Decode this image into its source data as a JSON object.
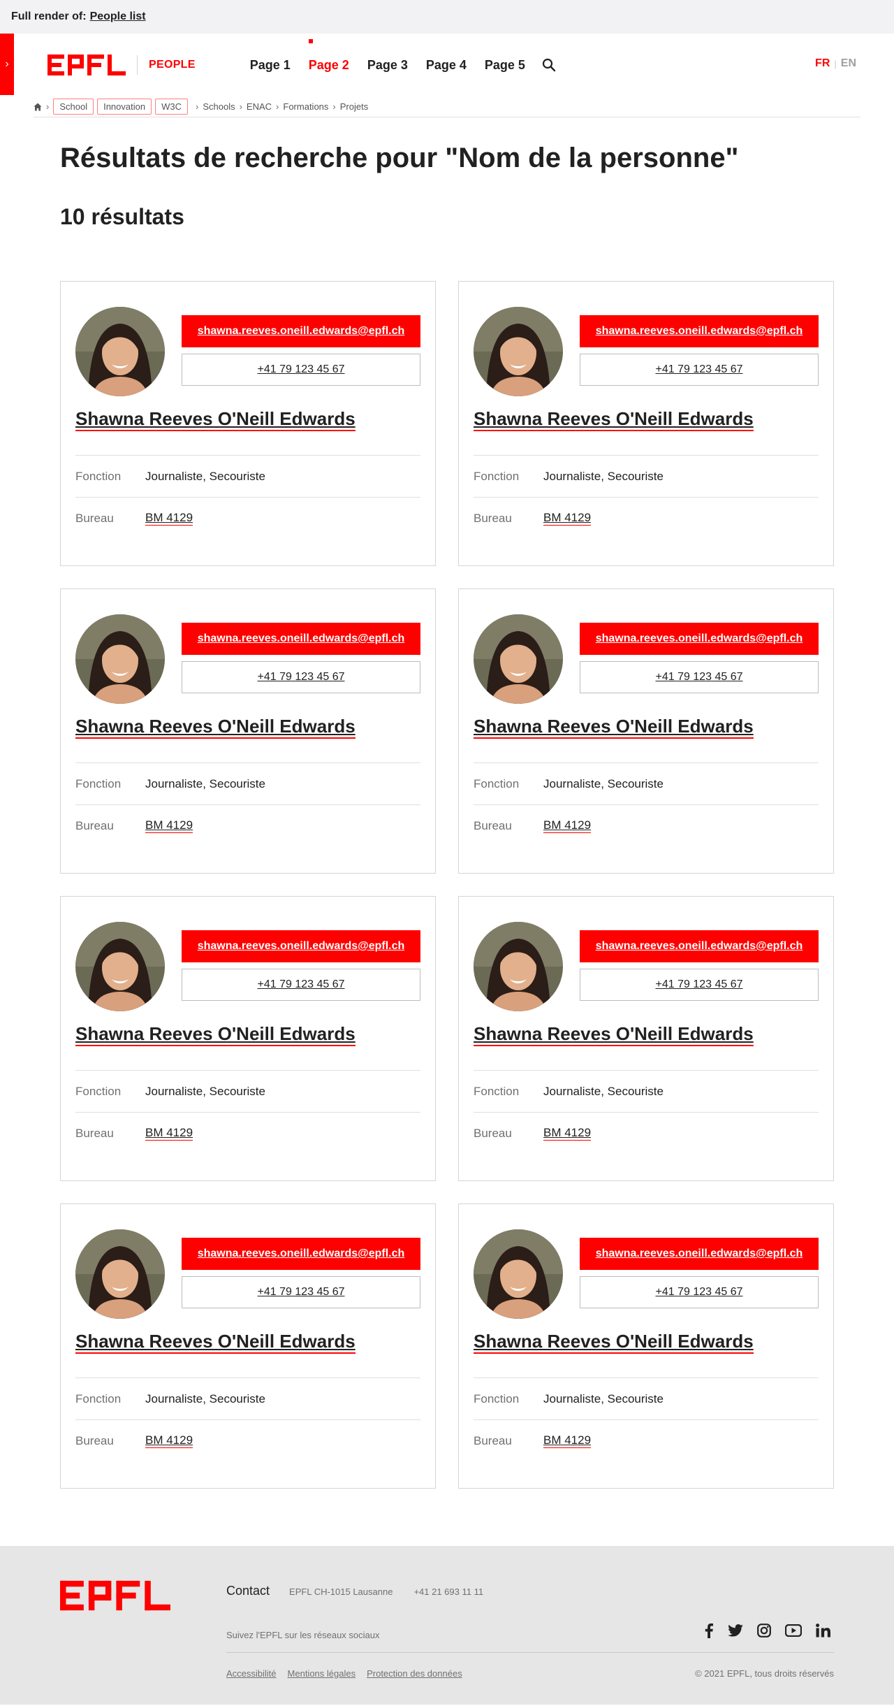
{
  "render_bar": {
    "prefix": "Full render of:",
    "link": "People list"
  },
  "header": {
    "site_label": "PEOPLE",
    "nav": [
      {
        "label": "Page 1",
        "active": false
      },
      {
        "label": "Page 2",
        "active": true
      },
      {
        "label": "Page 3",
        "active": false
      },
      {
        "label": "Page 4",
        "active": false
      },
      {
        "label": "Page 5",
        "active": false
      }
    ],
    "lang_active": "FR",
    "lang_other": "EN"
  },
  "breadcrumb": {
    "tags": [
      "School",
      "Innovation",
      "W3C"
    ],
    "links": [
      "Schools",
      "ENAC",
      "Formations",
      "Projets"
    ]
  },
  "main": {
    "title": "Résultats de recherche pour \"Nom de la personne\"",
    "count": "10 résultats"
  },
  "people": [
    {
      "email": "shawna.reeves.oneill.edwards@epfl.ch",
      "phone": "+41 79 123 45 67",
      "name": "Shawna Reeves O'Neill Edwards",
      "fonction_label": "Fonction",
      "fonction": "Journaliste, Secouriste",
      "bureau_label": "Bureau",
      "bureau": "BM 4129"
    },
    {
      "email": "shawna.reeves.oneill.edwards@epfl.ch",
      "phone": "+41 79 123 45 67",
      "name": "Shawna Reeves O'Neill Edwards",
      "fonction_label": "Fonction",
      "fonction": "Journaliste, Secouriste",
      "bureau_label": "Bureau",
      "bureau": "BM 4129"
    },
    {
      "email": "shawna.reeves.oneill.edwards@epfl.ch",
      "phone": "+41 79 123 45 67",
      "name": "Shawna Reeves O'Neill Edwards",
      "fonction_label": "Fonction",
      "fonction": "Journaliste, Secouriste",
      "bureau_label": "Bureau",
      "bureau": "BM 4129"
    },
    {
      "email": "shawna.reeves.oneill.edwards@epfl.ch",
      "phone": "+41 79 123 45 67",
      "name": "Shawna Reeves O'Neill Edwards",
      "fonction_label": "Fonction",
      "fonction": "Journaliste, Secouriste",
      "bureau_label": "Bureau",
      "bureau": "BM 4129"
    },
    {
      "email": "shawna.reeves.oneill.edwards@epfl.ch",
      "phone": "+41 79 123 45 67",
      "name": "Shawna Reeves O'Neill Edwards",
      "fonction_label": "Fonction",
      "fonction": "Journaliste, Secouriste",
      "bureau_label": "Bureau",
      "bureau": "BM 4129"
    },
    {
      "email": "shawna.reeves.oneill.edwards@epfl.ch",
      "phone": "+41 79 123 45 67",
      "name": "Shawna Reeves O'Neill Edwards",
      "fonction_label": "Fonction",
      "fonction": "Journaliste, Secouriste",
      "bureau_label": "Bureau",
      "bureau": "BM 4129"
    },
    {
      "email": "shawna.reeves.oneill.edwards@epfl.ch",
      "phone": "+41 79 123 45 67",
      "name": "Shawna Reeves O'Neill Edwards",
      "fonction_label": "Fonction",
      "fonction": "Journaliste, Secouriste",
      "bureau_label": "Bureau",
      "bureau": "BM 4129"
    },
    {
      "email": "shawna.reeves.oneill.edwards@epfl.ch",
      "phone": "+41 79 123 45 67",
      "name": "Shawna Reeves O'Neill Edwards",
      "fonction_label": "Fonction",
      "fonction": "Journaliste, Secouriste",
      "bureau_label": "Bureau",
      "bureau": "BM 4129"
    }
  ],
  "footer": {
    "contact_title": "Contact",
    "address": "EPFL CH-1015 Lausanne",
    "phone": "+41 21 693 11 11",
    "social_text": "Suivez l'EPFL sur les réseaux sociaux",
    "social_icons": [
      "facebook-icon",
      "twitter-icon",
      "instagram-icon",
      "youtube-icon",
      "linkedin-icon"
    ],
    "links": [
      "Accessibilité",
      "Mentions légales",
      "Protection des données"
    ],
    "copyright": "© 2021 EPFL, tous droits réservés"
  },
  "colors": {
    "brand": "#ff0000",
    "text": "#212121",
    "muted": "#707070",
    "footer_bg": "#e6e6e6"
  }
}
